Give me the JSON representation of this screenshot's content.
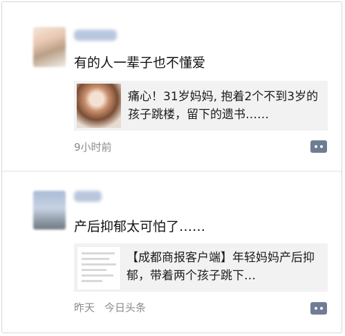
{
  "posts": [
    {
      "content": "有的人一辈子也不懂爱",
      "card_text": "痛心！31岁妈妈, 抱着2个不到3岁的孩子跳楼，留下的遗书……",
      "time": "9小时前",
      "source": ""
    },
    {
      "content": "产后抑郁太可怕了……",
      "card_text": "【成都商报客户端】年轻妈妈产后抑郁，带着两个孩子跳下…",
      "time": "昨天",
      "source": "今日头条"
    }
  ],
  "icons": {
    "comment": "comment-icon"
  },
  "colors": {
    "comment_button": "#6f7d94",
    "card_bg": "#f2f2f2",
    "meta_text": "#8a8a8a"
  }
}
